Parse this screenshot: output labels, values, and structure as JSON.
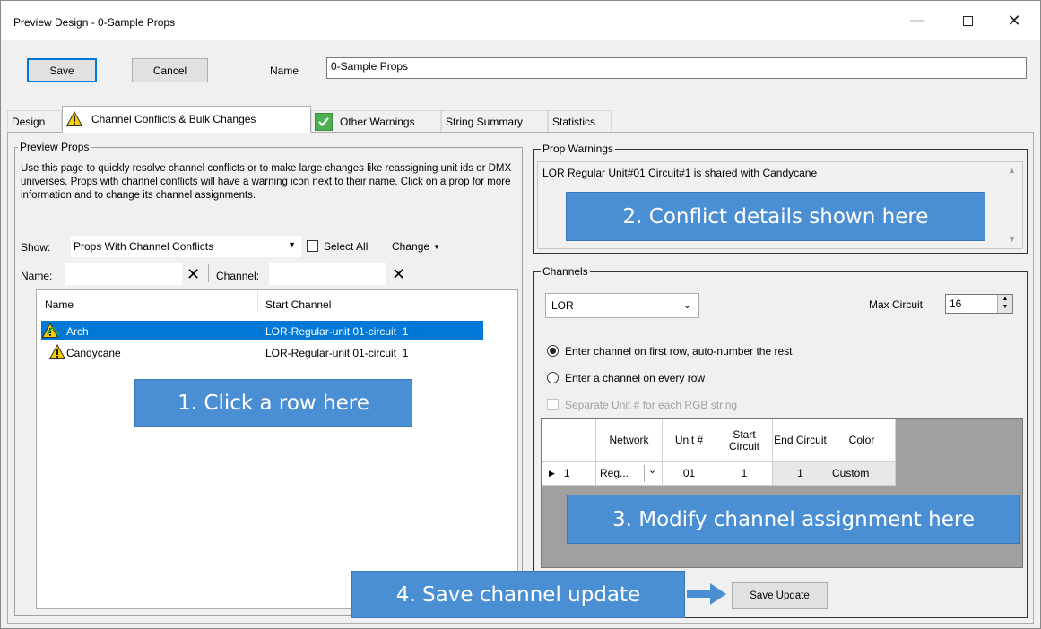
{
  "window": {
    "title": "Preview Design - 0-Sample Props"
  },
  "toolbar": {
    "save_label": "Save",
    "cancel_label": "Cancel",
    "name_label": "Name",
    "name_value": "0-Sample Props"
  },
  "tabs": [
    {
      "label": "Design"
    },
    {
      "label": "Channel Conflicts & Bulk Changes"
    },
    {
      "label": "Other Warnings"
    },
    {
      "label": "String Summary"
    },
    {
      "label": "Statistics"
    }
  ],
  "preview_props": {
    "legend": "Preview Props",
    "description": "Use this page to quickly resolve channel conflicts or to make large changes like reassigning unit ids or DMX universes. Props with channel conflicts will have a warning icon next to their name. Click on a prop for more information and to change its channel assignments.",
    "show_label": "Show:",
    "show_value": "Props With Channel Conflicts",
    "select_all_label": "Select All",
    "change_label": "Change",
    "name_filter_label": "Name:",
    "channel_filter_label": "Channel:",
    "columns": [
      "Name",
      "Start Channel"
    ],
    "rows": [
      {
        "name": "Arch",
        "start_channel": "LOR-Regular-unit 01-circuit  1",
        "selected": true
      },
      {
        "name": "Candycane",
        "start_channel": "LOR-Regular-unit 01-circuit  1",
        "selected": false
      }
    ]
  },
  "prop_warnings": {
    "legend": "Prop Warnings",
    "text": "LOR Regular Unit#01 Circuit#1 is shared with Candycane"
  },
  "channels": {
    "legend": "Channels",
    "network_value": "LOR",
    "max_circuit_label": "Max Circuit",
    "max_circuit_value": "16",
    "radio1_label": "Enter channel on first row, auto-number the rest",
    "radio2_label": "Enter a channel on every row",
    "separate_unit_label": "Separate Unit # for each RGB string",
    "grid_columns": [
      "Network",
      "Unit #",
      "Start Circuit",
      "End Circuit",
      "Color"
    ],
    "grid_rows": [
      {
        "index": "1",
        "network": "Reg...",
        "unit": "01",
        "start": "1",
        "end": "1",
        "color": "Custom"
      }
    ],
    "save_update_label": "Save Update"
  },
  "callouts": {
    "c1": "1. Click a row here",
    "c2": "2. Conflict details shown here",
    "c3": "3. Modify channel assignment here",
    "c4": "4. Save channel update"
  },
  "colors": {
    "accent": "#0078d7",
    "callout": "#4a8fd4",
    "warning": "#f5d000",
    "ok": "#4caf50"
  },
  "icons": {
    "warning": "warning-icon",
    "check": "check-icon",
    "close": "close-icon",
    "clear": "clear-icon",
    "arrow": "arrow-right-icon"
  }
}
